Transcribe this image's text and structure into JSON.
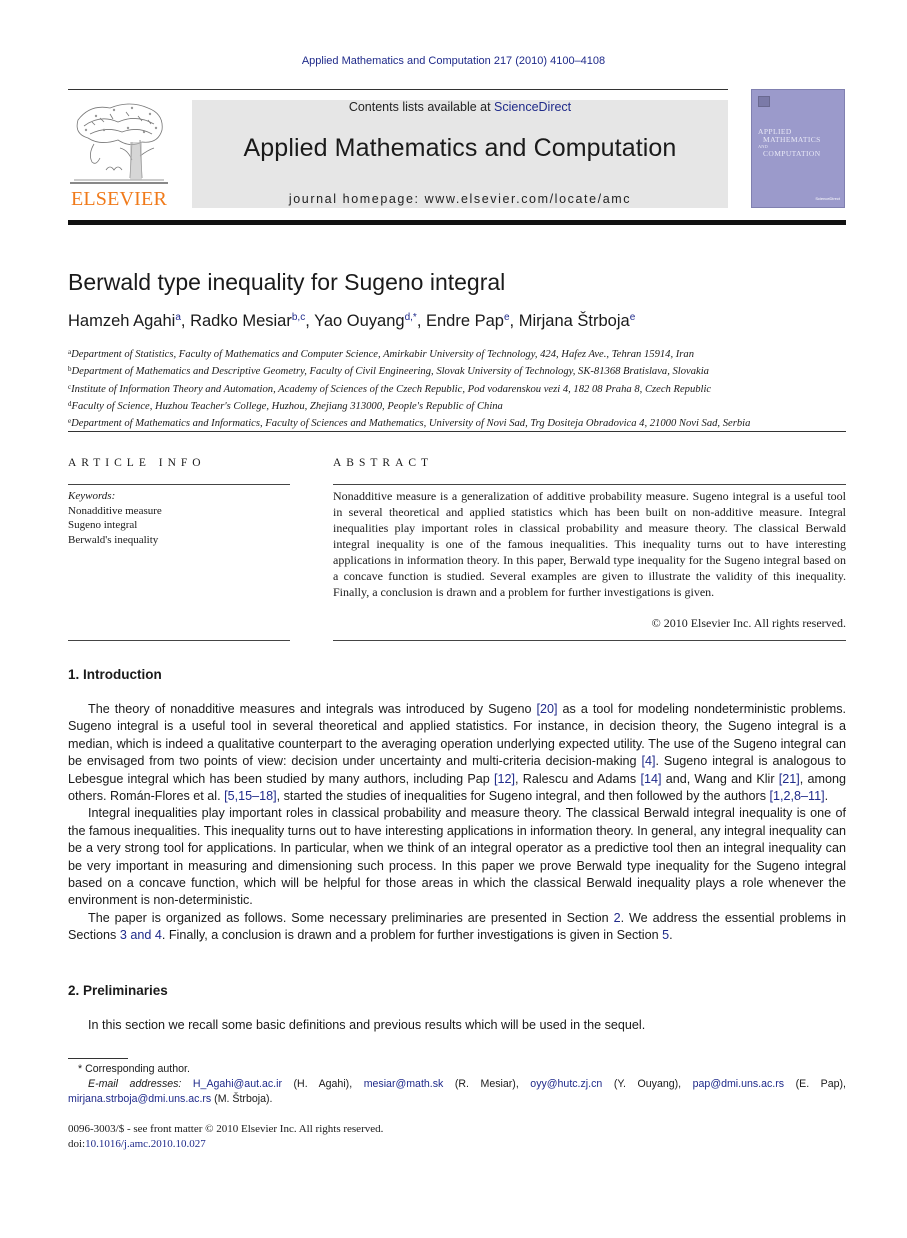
{
  "running_head": "Applied Mathematics and Computation 217 (2010) 4100–4108",
  "header": {
    "publisher_logo_text": "ELSEVIER",
    "contents_prefix": "Contents lists available at ",
    "contents_link": "ScienceDirect",
    "journal_title": "Applied Mathematics and Computation",
    "homepage": "journal homepage: www.elsevier.com/locate/amc",
    "cover": {
      "line1": "APPLIED",
      "line2": "MATHEMATICS",
      "line3": "AND",
      "line4": "COMPUTATION",
      "badge": "ScienceDirect",
      "color": "#9b9acb"
    },
    "logo_color": "#f07a1a"
  },
  "article": {
    "title": "Berwald type inequality for Sugeno integral",
    "authors": [
      {
        "name": "Hamzeh Agahi",
        "sup": "a",
        "sep": ", "
      },
      {
        "name": "Radko Mesiar",
        "sup": "b,c",
        "sep": ", "
      },
      {
        "name": "Yao Ouyang",
        "sup": "d,*",
        "sep": ", "
      },
      {
        "name": "Endre Pap",
        "sup": "e",
        "sep": ", "
      },
      {
        "name": "Mirjana Štrboja",
        "sup": "e",
        "sep": ""
      }
    ],
    "affiliations": [
      {
        "key": "a",
        "text": "Department of Statistics, Faculty of Mathematics and Computer Science, Amirkabir University of Technology, 424, Hafez Ave., Tehran 15914, Iran"
      },
      {
        "key": "b",
        "text": "Department of Mathematics and Descriptive Geometry, Faculty of Civil Engineering, Slovak University of Technology, SK-81368 Bratislava, Slovakia"
      },
      {
        "key": "c",
        "text": "Institute of Information Theory and Automation, Academy of Sciences of the Czech Republic, Pod vodarenskou vezi 4, 182 08 Praha 8, Czech Republic"
      },
      {
        "key": "d",
        "text": "Faculty of Science, Huzhou Teacher's College, Huzhou, Zhejiang 313000, People's Republic of China"
      },
      {
        "key": "e",
        "text": "Department of Mathematics and Informatics, Faculty of Sciences and Mathematics, University of Novi Sad, Trg Dositeja Obradovica 4, 21000 Novi Sad, Serbia"
      }
    ]
  },
  "article_info": {
    "heading": "ARTICLE INFO",
    "keywords_label": "Keywords:",
    "keywords": [
      "Nonadditive measure",
      "Sugeno integral",
      "Berwald's inequality"
    ]
  },
  "abstract": {
    "heading": "ABSTRACT",
    "text": "Nonadditive measure is a generalization of additive probability measure. Sugeno integral is a useful tool in several theoretical and applied statistics which has been built on non-additive measure. Integral inequalities play important roles in classical probability and measure theory. The classical Berwald integral inequality is one of the famous inequalities. This inequality turns out to have interesting applications in information theory. In this paper, Berwald type inequality for the Sugeno integral based on a concave function is studied. Several examples are given to illustrate the validity of this inequality. Finally, a conclusion is drawn and a problem for further investigations is given.",
    "copyright": "© 2010 Elsevier Inc. All rights reserved."
  },
  "sections": {
    "intro": {
      "heading": "1. Introduction",
      "p1": [
        {
          "t": "The theory of nonadditive measures and integrals was introduced by Sugeno "
        },
        {
          "t": "[20]",
          "link": true
        },
        {
          "t": " as a tool for modeling nondeterministic problems. Sugeno integral is a useful tool in several theoretical and applied statistics. For instance, in decision theory, the Sugeno integral is a median, which is indeed a qualitative counterpart to the averaging operation underlying expected utility. The use of the Sugeno integral can be envisaged from two points of view: decision under uncertainty and multi-criteria decision-making "
        },
        {
          "t": "[4]",
          "link": true
        },
        {
          "t": ". Sugeno integral is analogous to Lebesgue integral which has been studied by many authors, including Pap "
        },
        {
          "t": "[12]",
          "link": true
        },
        {
          "t": ", Ralescu and Adams "
        },
        {
          "t": "[14]",
          "link": true
        },
        {
          "t": " and, Wang and Klir "
        },
        {
          "t": "[21]",
          "link": true
        },
        {
          "t": ", among others. Román-Flores et al. "
        },
        {
          "t": "[5,15–18]",
          "link": true
        },
        {
          "t": ", started the studies of inequalities for Sugeno integral, and then followed by the authors "
        },
        {
          "t": "[1,2,8–11]",
          "link": true
        },
        {
          "t": "."
        }
      ],
      "p2": "Integral inequalities play important roles in classical probability and measure theory. The classical Berwald integral inequality is one of the famous inequalities. This inequality turns out to have interesting applications in information theory. In general, any integral inequality can be a very strong tool for applications. In particular, when we think of an integral operator as a predictive tool then an integral inequality can be very important in measuring and dimensioning such process. In this paper we prove Berwald type inequality for the Sugeno integral based on a concave function, which will be helpful for those areas in which the classical Berwald inequality plays a role whenever the environment is non-deterministic.",
      "p3": [
        {
          "t": "The paper is organized as follows. Some necessary preliminaries are presented in Section "
        },
        {
          "t": "2",
          "link": true
        },
        {
          "t": ". We address the essential problems in Sections "
        },
        {
          "t": "3 and 4",
          "link": true
        },
        {
          "t": ". Finally, a conclusion is drawn and a problem for further investigations is given in Section "
        },
        {
          "t": "5",
          "link": true
        },
        {
          "t": "."
        }
      ]
    },
    "prelim": {
      "heading": "2. Preliminaries",
      "p1": "In this section we recall some basic definitions and previous results which will be used in the sequel."
    }
  },
  "footnotes": {
    "corresponding": "* Corresponding author.",
    "email_label": "E-mail addresses:",
    "emails": [
      {
        "addr": "H_Agahi@aut.ac.ir",
        "who": " (H. Agahi), "
      },
      {
        "addr": "mesiar@math.sk",
        "who": " (R. Mesiar), "
      },
      {
        "addr": "oyy@hutc.zj.cn",
        "who": " (Y. Ouyang), "
      },
      {
        "addr": "pap@dmi.uns.ac.rs",
        "who": " (E. Pap), "
      },
      {
        "addr": "mirjana.strboja@dmi.uns.ac.rs",
        "who": " (M. Štrboja)."
      }
    ]
  },
  "bottom_meta": {
    "issn": "0096-3003/$ - see front matter © 2010 Elsevier Inc. All rights reserved.",
    "doi_prefix": "doi:",
    "doi": "10.1016/j.amc.2010.10.027"
  },
  "colors": {
    "link": "#1f2a8a",
    "banner_bg": "#e6e6e6",
    "elsevier_orange": "#f07a1a"
  }
}
